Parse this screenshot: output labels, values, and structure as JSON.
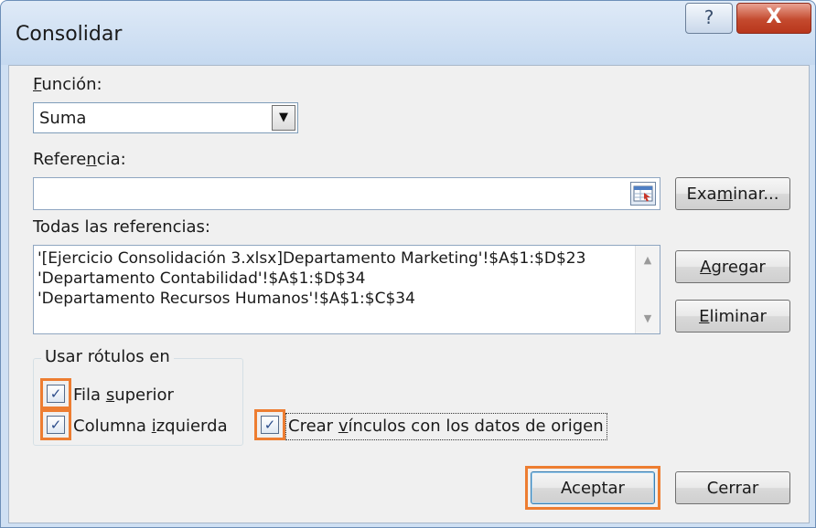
{
  "window": {
    "title": "Consolidar",
    "help_glyph": "?",
    "close_glyph": "X"
  },
  "funcion": {
    "label_mnemonic": "F",
    "label_rest": "unción:",
    "selected": "Suma",
    "dropdown_glyph": "▼"
  },
  "referencia": {
    "label_pre": "Refere",
    "label_mnemonic": "n",
    "label_post": "cia:",
    "value": ""
  },
  "examinar": {
    "pre": "Exa",
    "mnemonic": "m",
    "post": "inar..."
  },
  "todas": {
    "label": "Todas las referencias:",
    "items": [
      "'[Ejercicio Consolidación 3.xlsx]Departamento Marketing'!$A$1:$D$23",
      "'Departamento Contabilidad'!$A$1:$D$34",
      "'Departamento Recursos Humanos'!$A$1:$C$34"
    ],
    "scroll_up": "▲",
    "scroll_down": "▼"
  },
  "agregar": {
    "mnemonic": "A",
    "rest": "gregar"
  },
  "eliminar": {
    "mnemonic": "E",
    "rest": "liminar"
  },
  "rotulos": {
    "group_label": "Usar rótulos en",
    "fila_pre": "Fila ",
    "fila_mnemonic": "s",
    "fila_post": "uperior",
    "fila_checked": true,
    "columna_pre": "Columna ",
    "columna_mnemonic": "i",
    "columna_post": "zquierda",
    "columna_checked": true
  },
  "vinculos": {
    "pre": "Crear ",
    "mnemonic": "v",
    "post": "ínculos con los datos de origen",
    "checked": true
  },
  "check_glyph": "✓",
  "buttons": {
    "aceptar": "Aceptar",
    "cerrar": "Cerrar"
  },
  "colors": {
    "highlight": "#ed7d31",
    "close_button": "#c44a2e",
    "dialog_bg": "#f0f0f0",
    "frame": "#cfe0f3"
  }
}
